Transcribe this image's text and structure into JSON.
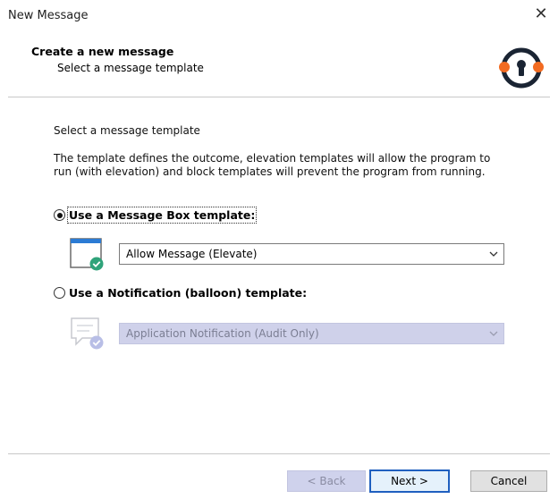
{
  "window": {
    "title": "New Message",
    "close_glyph": "✕"
  },
  "header": {
    "title": "Create a new message",
    "subtitle": "Select a message template",
    "logo_icon": "privilege-manager-lock-logo-icon"
  },
  "body": {
    "section_label": "Select a message template",
    "description_line1": "The template defines the outcome, elevation templates will allow the program to",
    "description_line2": "run (with elevation) and block templates will prevent the program from running."
  },
  "options": {
    "message_box": {
      "label": "Use a Message Box template:",
      "selected": true,
      "icon": "message-box-window-check-icon",
      "dropdown_value": "Allow Message (Elevate)"
    },
    "notification": {
      "label": "Use a Notification (balloon) template:",
      "selected": false,
      "icon": "notification-balloon-check-icon",
      "dropdown_value": "Application Notification (Audit Only)"
    }
  },
  "footer": {
    "back_label": "< Back",
    "next_label": "Next >",
    "cancel_label": "Cancel"
  },
  "colors": {
    "accent_orange": "#f26b21",
    "logo_dark": "#1a2433",
    "check_green": "#2fa37a",
    "icon_blue": "#2b7bd4",
    "disabled_fill": "#cfd1ea"
  }
}
